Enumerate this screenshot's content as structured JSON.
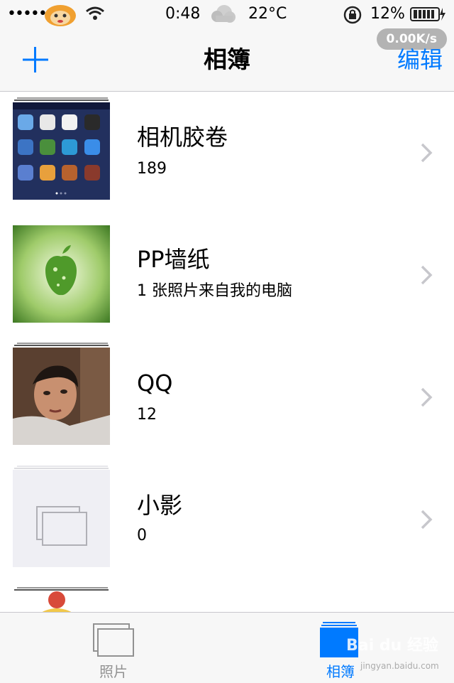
{
  "status_bar": {
    "signal": "•••••",
    "time": "0:48",
    "weather_icon": "cloud-weather-icon",
    "temperature": "22°C",
    "battery_percent": "12%",
    "net_speed": "0.00K/s"
  },
  "nav": {
    "title": "相簿",
    "edit_label": "编辑",
    "add_icon": "plus-icon"
  },
  "albums": [
    {
      "name": "相机胶卷",
      "count": "189",
      "thumb": "iphone-homescreen-thumbnail"
    },
    {
      "name": "PP墙纸",
      "count": "1 张照片来自我的电脑",
      "thumb": "green-apple-wallpaper-thumbnail"
    },
    {
      "name": "QQ",
      "count": "12",
      "thumb": "selfie-photo-thumbnail"
    },
    {
      "name": "小影",
      "count": "0",
      "thumb": "empty-album-placeholder"
    }
  ],
  "tabs": [
    {
      "label": "照片",
      "icon": "photos-icon",
      "active": false
    },
    {
      "label": "相簿",
      "icon": "albums-icon",
      "active": true
    }
  ],
  "watermark": {
    "text": "Bai du 经验",
    "sub": "jingyan.baidu.com"
  },
  "colors": {
    "accent": "#007aff",
    "chevron": "#c7c7cc",
    "bar_background": "#f7f7f7"
  }
}
